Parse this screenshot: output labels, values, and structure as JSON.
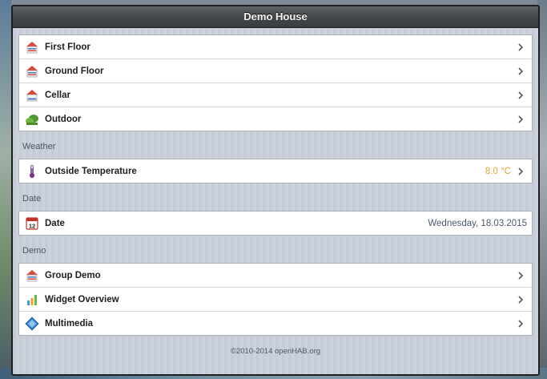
{
  "app": {
    "title": "Demo House"
  },
  "main_items": [
    {
      "label": "First Floor",
      "icon": "house-icon"
    },
    {
      "label": "Ground Floor",
      "icon": "house-icon"
    },
    {
      "label": "Cellar",
      "icon": "house-icon"
    },
    {
      "label": "Outdoor",
      "icon": "garden-icon"
    }
  ],
  "weather": {
    "section_title": "Weather",
    "items": [
      {
        "label": "Outside Temperature",
        "value": "8.0 °C",
        "icon": "thermometer-icon"
      }
    ]
  },
  "date": {
    "section_title": "Date",
    "items": [
      {
        "label": "Date",
        "value": "Wednesday, 18.03.2015",
        "icon": "calendar-icon",
        "icon_text": "12"
      }
    ]
  },
  "demo": {
    "section_title": "Demo",
    "items": [
      {
        "label": "Group Demo",
        "icon": "house-icon"
      },
      {
        "label": "Widget Overview",
        "icon": "bar-chart-icon"
      },
      {
        "label": "Multimedia",
        "icon": "media-icon"
      }
    ]
  },
  "footer": {
    "text": "©2010-2014 openHAB.org"
  },
  "colors": {
    "value_orange": "#e8a13b",
    "value_blue": "#4a5a6d",
    "header_dark": "#3a3d40"
  }
}
